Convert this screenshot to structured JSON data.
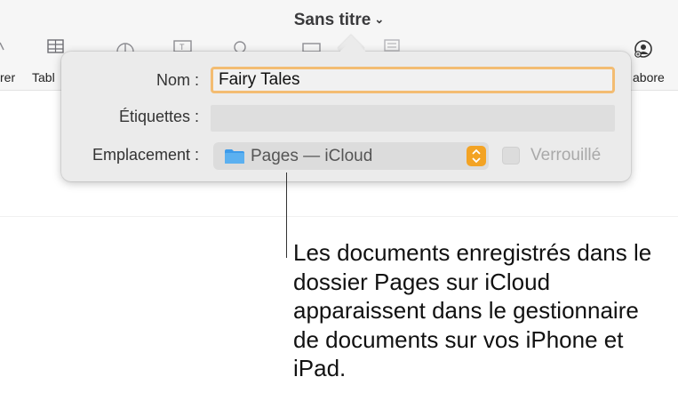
{
  "window": {
    "title": "Sans titre"
  },
  "toolbar": {
    "left_fragment": "rer",
    "table_fragment": "Tabl",
    "right_fragment": "abore"
  },
  "popover": {
    "name_label": "Nom :",
    "name_value": "Fairy Tales",
    "tags_label": "Étiquettes :",
    "tags_value": "",
    "location_label": "Emplacement :",
    "location_value": "Pages — iCloud",
    "locked_label": "Verrouillé",
    "locked_checked": false
  },
  "callout": {
    "text": "Les documents enregistrés dans le dossier Pages sur iCloud apparaissent dans le gestionnaire de documents sur vos iPhone et iPad."
  },
  "colors": {
    "focus_ring": "#f3bc72",
    "stepper": "#f3a324",
    "folder": "#3d9bea"
  }
}
